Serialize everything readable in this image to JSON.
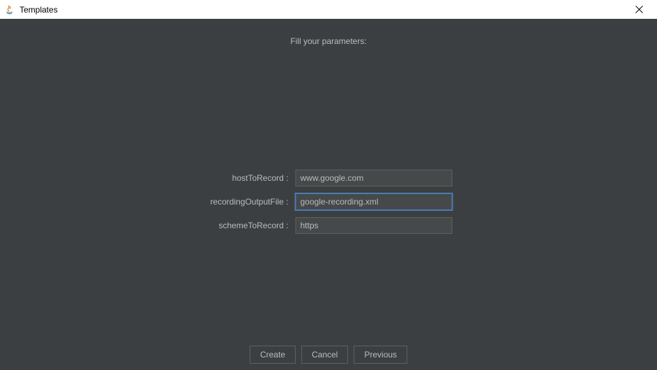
{
  "window": {
    "title": "Templates"
  },
  "prompt": "Fill your parameters:",
  "fields": [
    {
      "label": "hostToRecord :",
      "value": "www.google.com",
      "focused": false
    },
    {
      "label": "recordingOutputFile :",
      "value": "google-recording.xml",
      "focused": true
    },
    {
      "label": "schemeToRecord :",
      "value": "https",
      "focused": false
    }
  ],
  "buttons": {
    "create": "Create",
    "cancel": "Cancel",
    "previous": "Previous"
  }
}
